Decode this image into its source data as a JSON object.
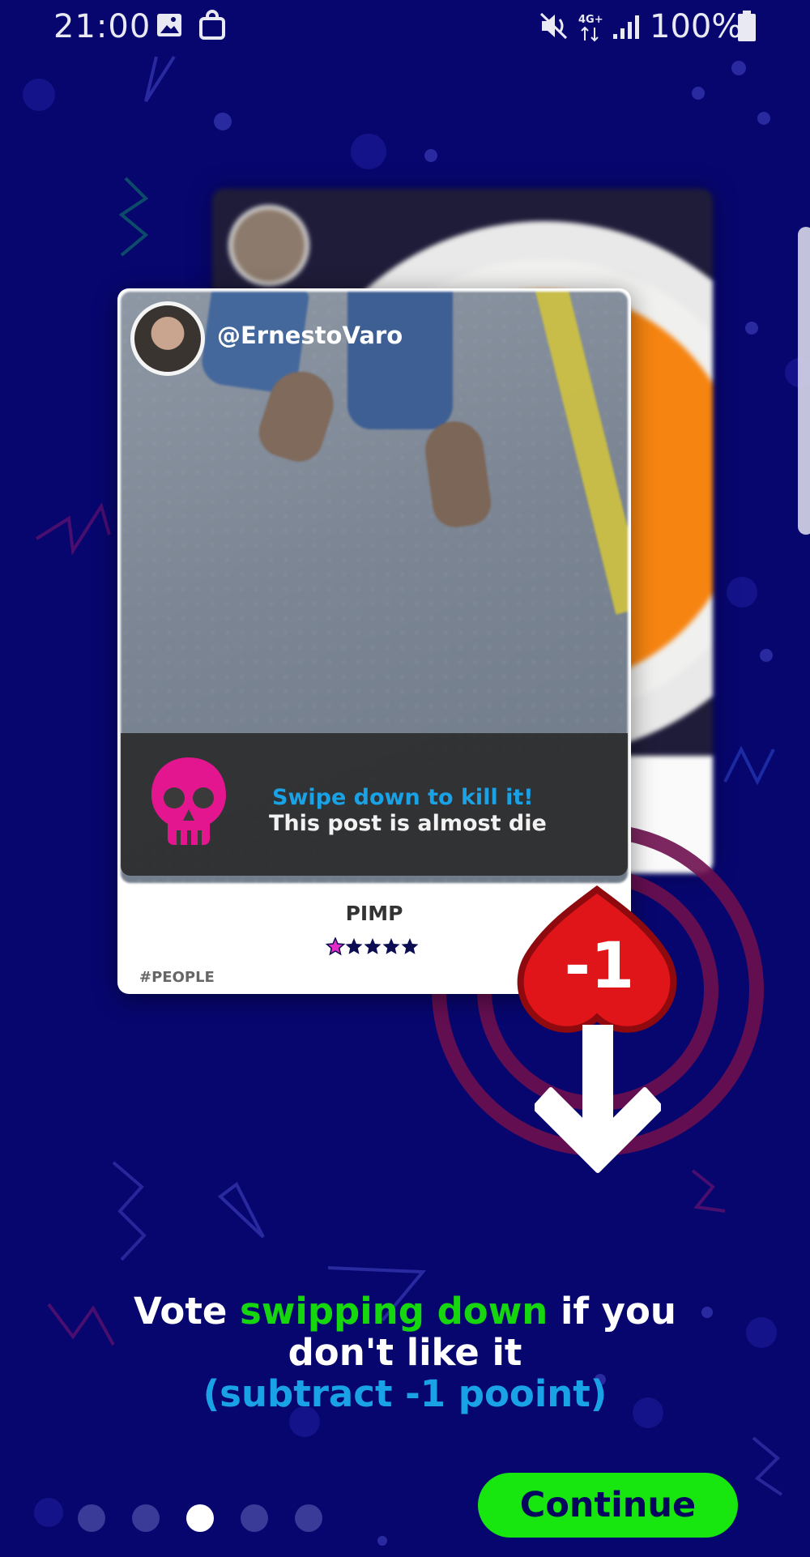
{
  "status_bar": {
    "time": "21:00",
    "battery": "100%",
    "network": "4G+",
    "icons": [
      "image-icon",
      "bag-icon",
      "mute-icon",
      "signal-icon",
      "battery-icon"
    ]
  },
  "front_card": {
    "username": "@ErnestoVaro",
    "hint_title": "Swipe down to kill it!",
    "hint_subtitle": "This post is almost die",
    "category_label": "PIMP",
    "rating": {
      "filled": 1,
      "total": 5
    },
    "hashtag": "#PEOPLE"
  },
  "vote_badge": {
    "label": "-1"
  },
  "message": {
    "part1": "Vote ",
    "highlight": "swipping down",
    "part2": " if you",
    "line2": "don't like it",
    "line3": "(subtract -1 pooint)"
  },
  "pager": {
    "count": 5,
    "active_index": 2
  },
  "continue_button": {
    "label": "Continue"
  },
  "colors": {
    "background": "#07066f",
    "accent_green": "#16d60e",
    "accent_blue": "#1aa2e6",
    "skull_pink": "#e4168f",
    "heart_red": "#e0151a"
  }
}
